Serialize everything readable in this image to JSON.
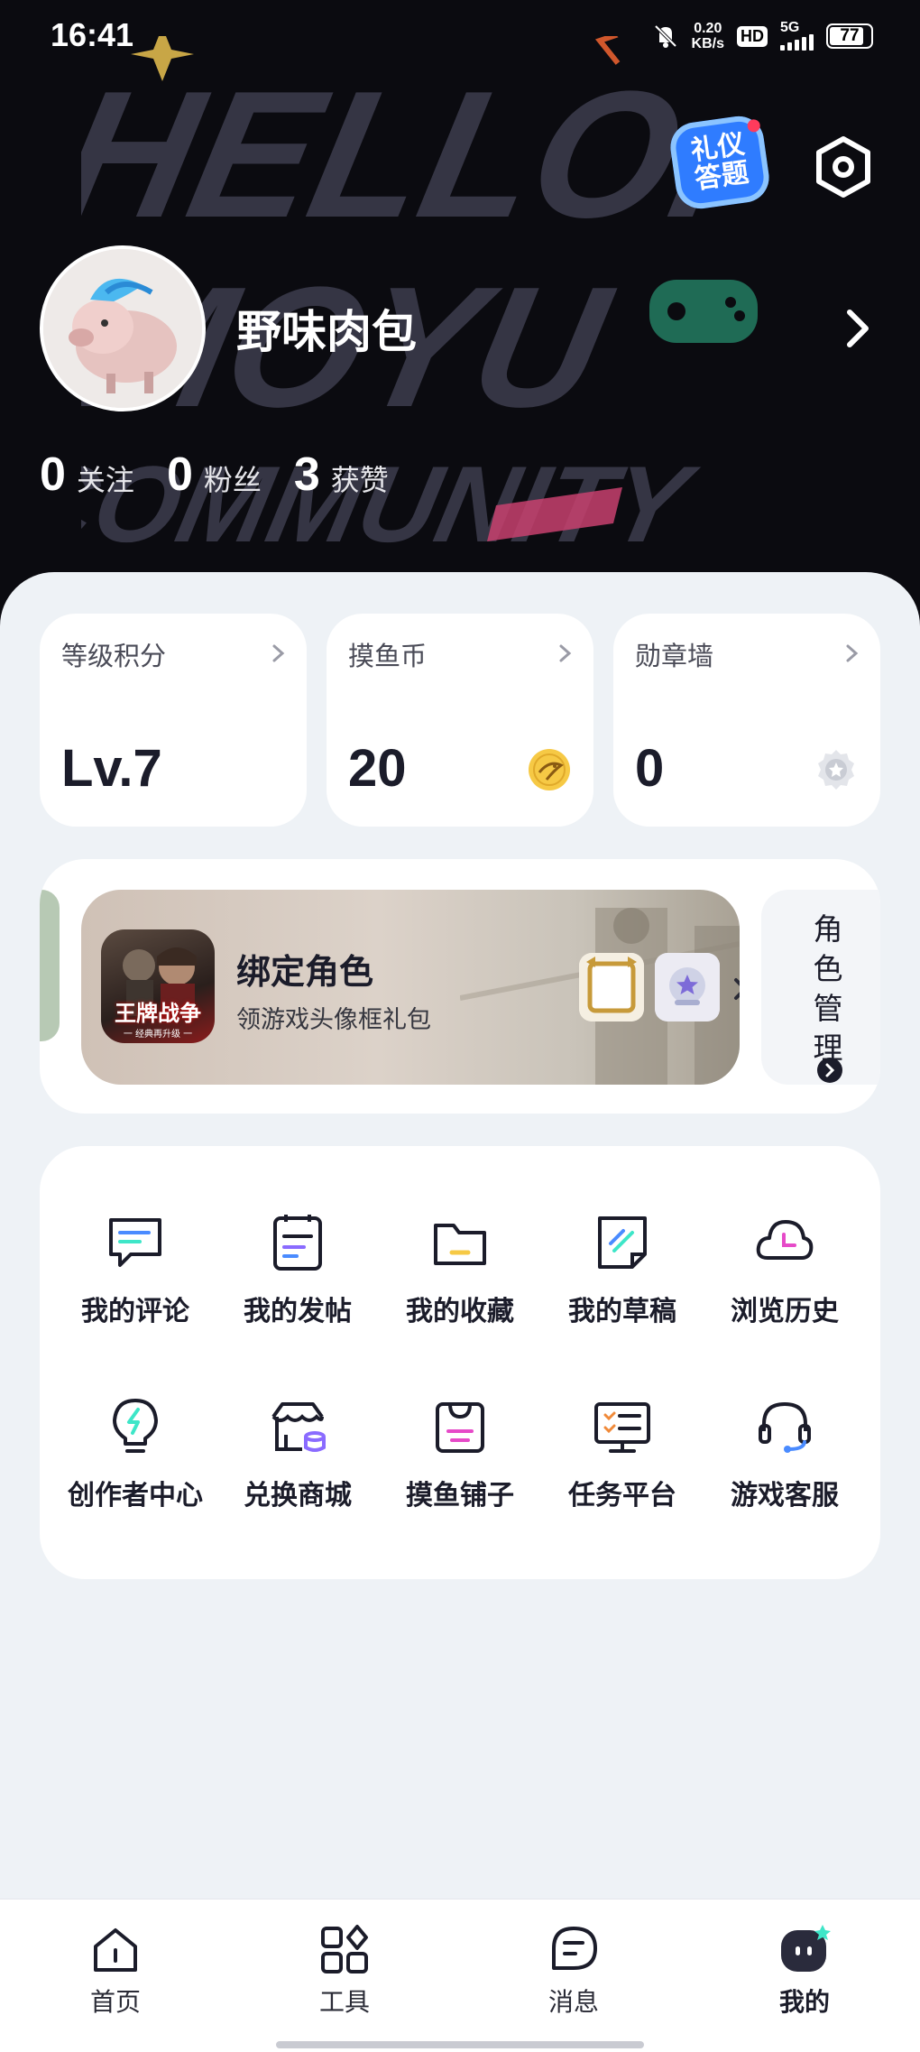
{
  "status_bar": {
    "time": "16:41",
    "net_speed_value": "0.20",
    "net_speed_unit": "KB/s",
    "hd": "HD",
    "network": "5G",
    "battery": "77"
  },
  "header": {
    "quiz_badge_line1": "礼仪",
    "quiz_badge_line2": "答题",
    "username": "野味肉包",
    "stats": [
      {
        "value": "0",
        "label": "关注"
      },
      {
        "value": "0",
        "label": "粉丝"
      },
      {
        "value": "3",
        "label": "获赞"
      }
    ],
    "background_text": [
      "HELLO.",
      "MOYU",
      "COMMUNITY"
    ]
  },
  "cards": [
    {
      "title": "等级积分",
      "value": "Lv.7"
    },
    {
      "title": "摸鱼币",
      "value": "20"
    },
    {
      "title": "勋章墙",
      "value": "0"
    }
  ],
  "role": {
    "game_name": "王牌战争",
    "game_subtitle": "一 经典再升级 一",
    "title": "绑定角色",
    "subtitle": "领游戏头像框礼包",
    "manage_label": "角色管理"
  },
  "menu": {
    "items": [
      {
        "label": "我的评论",
        "icon": "comment-icon"
      },
      {
        "label": "我的发帖",
        "icon": "post-icon"
      },
      {
        "label": "我的收藏",
        "icon": "folder-icon"
      },
      {
        "label": "我的草稿",
        "icon": "draft-icon"
      },
      {
        "label": "浏览历史",
        "icon": "history-icon"
      },
      {
        "label": "创作者中心",
        "icon": "lightbulb-icon"
      },
      {
        "label": "兑换商城",
        "icon": "shop-icon"
      },
      {
        "label": "摸鱼铺子",
        "icon": "store-bag-icon"
      },
      {
        "label": "任务平台",
        "icon": "task-board-icon"
      },
      {
        "label": "游戏客服",
        "icon": "headset-icon"
      }
    ]
  },
  "tabbar": {
    "tabs": [
      {
        "label": "首页",
        "icon": "home-icon"
      },
      {
        "label": "工具",
        "icon": "tools-icon"
      },
      {
        "label": "消息",
        "icon": "message-icon"
      },
      {
        "label": "我的",
        "icon": "profile-icon",
        "active": true
      }
    ]
  },
  "colors": {
    "accent_green": "#3ee6c8",
    "coin_yellow": "#f6c945",
    "header_bg": "#0b0b10"
  }
}
